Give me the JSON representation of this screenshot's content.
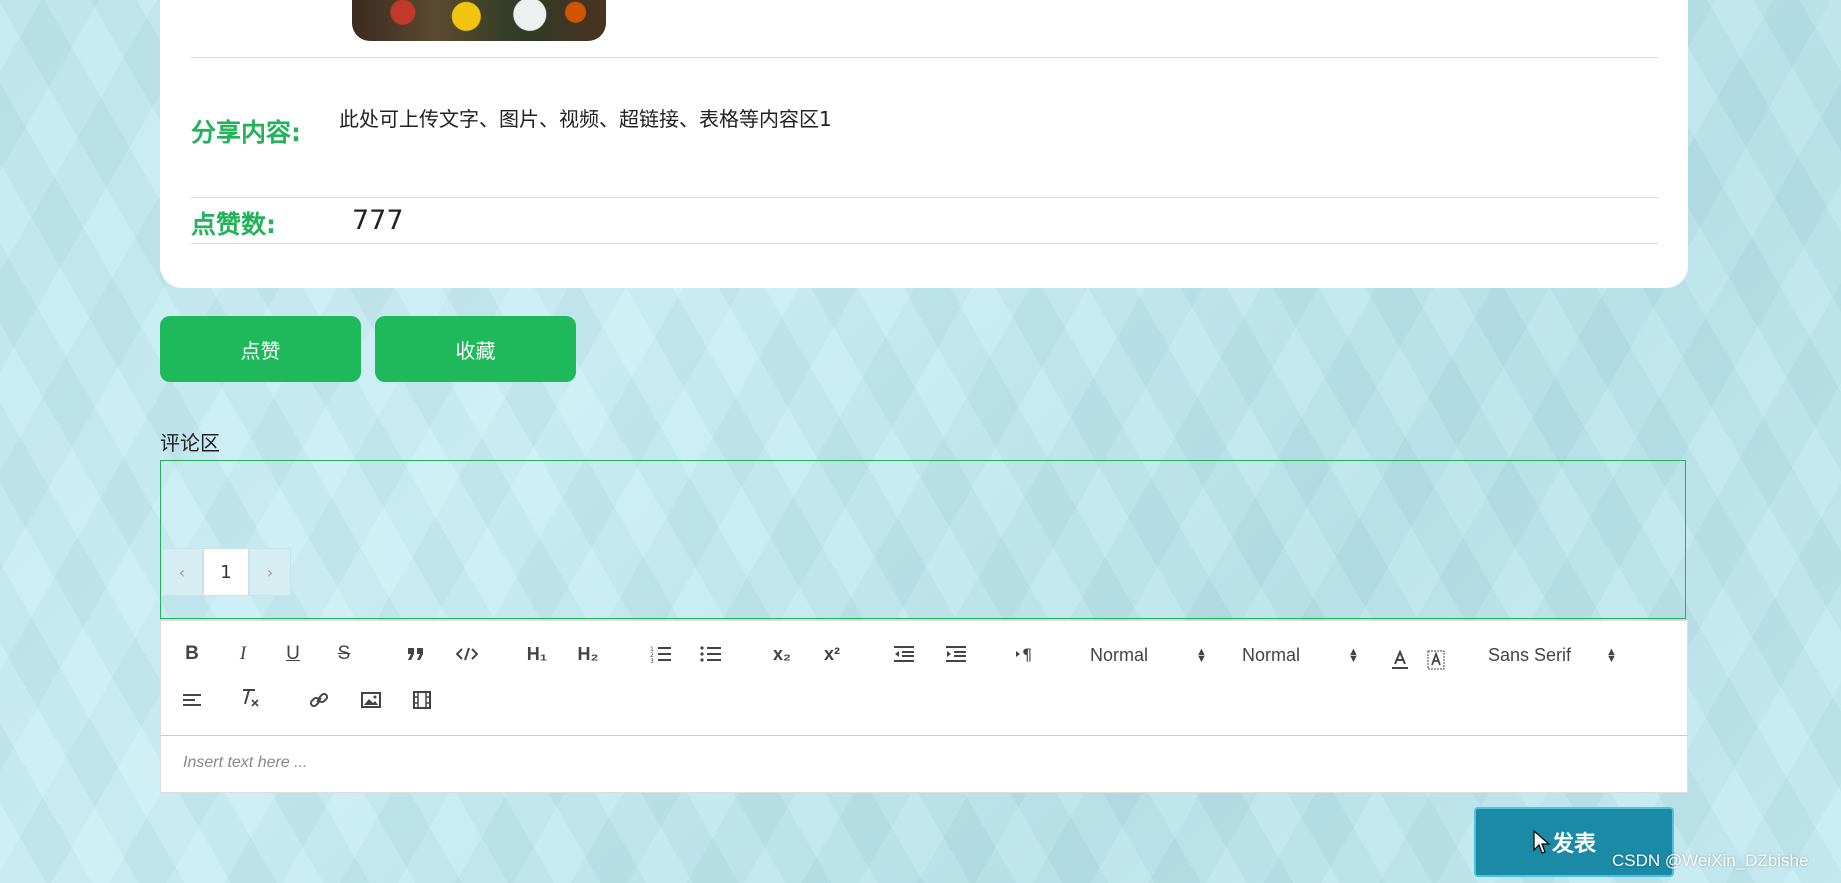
{
  "post": {
    "content_label": "分享内容:",
    "content_text": "此处可上传文字、图片、视频、超链接、表格等内容区1",
    "likes_label": "点赞数:",
    "likes_value": "777"
  },
  "actions": {
    "like_label": "点赞",
    "favorite_label": "收藏"
  },
  "comments": {
    "title": "评论区",
    "pager": {
      "prev": "‹",
      "current": "1",
      "next": "›"
    }
  },
  "editor": {
    "header_select": "Normal",
    "size_select": "Normal",
    "font_select": "Sans Serif",
    "placeholder": "Insert text here ...",
    "buttons": {
      "bold": "B",
      "italic": "I",
      "underline": "U",
      "strike": "S",
      "h1": "H₁",
      "h2": "H₂",
      "sub": "x₂",
      "sup": "x²"
    }
  },
  "submit": {
    "label": "发表"
  },
  "watermark": "CSDN @WeiXin_DZbishe",
  "colors": {
    "accent_green": "#22b35a",
    "submit_blue": "#1a8aa6"
  }
}
